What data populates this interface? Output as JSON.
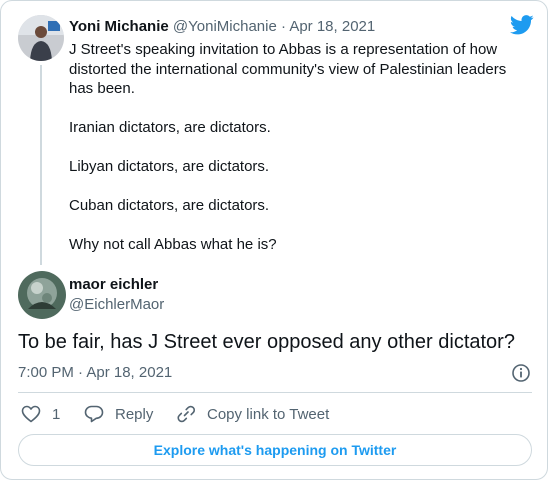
{
  "colors": {
    "accent": "#1d9bf0",
    "text": "#0f1419",
    "muted": "#536471",
    "border": "#cfd9de"
  },
  "parent_tweet": {
    "name": "Yoni Michanie",
    "handle": "@YoniMichanie",
    "separator": "·",
    "date": "Apr 18, 2021",
    "paragraphs": [
      "J Street's speaking invitation to Abbas is a representation of how distorted the international community's view of Palestinian leaders has been.",
      "Iranian dictators, are dictators.",
      "Libyan dictators, are dictators.",
      "Cuban dictators, are dictators.",
      "Why not call Abbas what he is?"
    ],
    "avatar_icon": "user-avatar"
  },
  "main_tweet": {
    "name": "maor eichler",
    "handle": "@EichlerMaor",
    "text": "To be fair, has J Street ever opposed any other dictator?",
    "timestamp": "7:00 PM · Apr 18, 2021",
    "avatar_icon": "user-avatar"
  },
  "actions": {
    "like_count": "1",
    "reply_label": "Reply",
    "copy_link_label": "Copy link to Tweet"
  },
  "explore_label": "Explore what's happening on Twitter",
  "icons": [
    "twitter-bird-icon",
    "info-icon",
    "heart-icon",
    "reply-icon",
    "link-icon"
  ]
}
